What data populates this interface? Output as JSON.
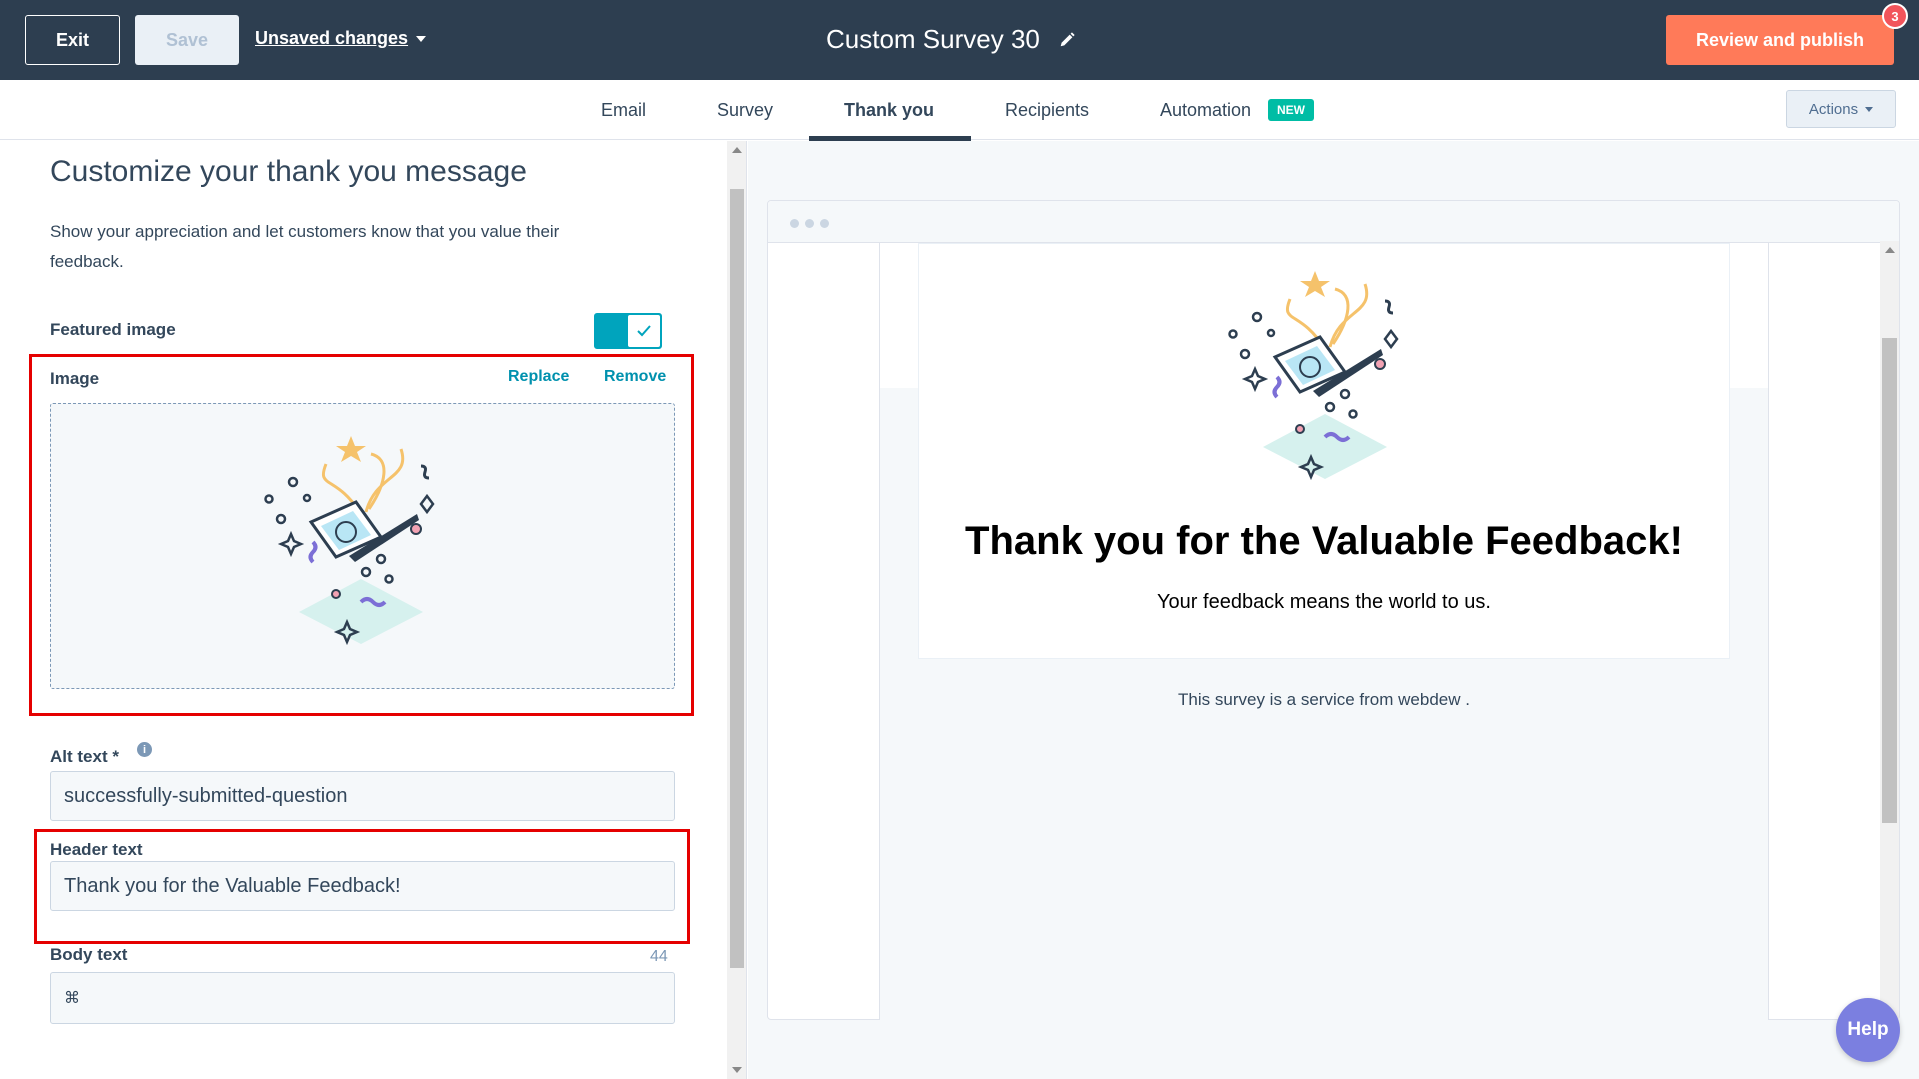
{
  "topbar": {
    "exit_label": "Exit",
    "save_label": "Save",
    "unsaved_label": "Unsaved changes",
    "survey_title": "Custom Survey 30",
    "review_label": "Review and publish",
    "notification_count": "3"
  },
  "tabs": {
    "items": [
      {
        "label": "Email"
      },
      {
        "label": "Survey"
      },
      {
        "label": "Thank you"
      },
      {
        "label": "Recipients"
      },
      {
        "label": "Automation"
      }
    ],
    "active": "Thank you",
    "new_badge": "NEW",
    "actions_label": "Actions"
  },
  "editor": {
    "title": "Customize your thank you message",
    "description": "Show your appreciation and let customers know that you value their feedback.",
    "featured_image_label": "Featured image",
    "featured_image_enabled": true,
    "image_label": "Image",
    "replace_label": "Replace",
    "remove_label": "Remove",
    "alt_text_label": "Alt text *",
    "alt_text_value": "successfully-submitted-question",
    "header_text_label": "Header text",
    "header_text_value": "Thank you for the Valuable Feedback!",
    "header_char_count": "44",
    "body_text_label": "Body text"
  },
  "preview": {
    "header": "Thank you for the Valuable Feedback!",
    "body": "Your feedback means the world to us.",
    "footer": "This survey is a service from webdew ."
  },
  "help_label": "Help",
  "colors": {
    "topbar": "#2d3e50",
    "accent_orange": "#ff7a59",
    "teal": "#00a4bd",
    "highlight_red": "#e50000",
    "new_badge": "#00bda5",
    "help_button": "#7b7fe0"
  }
}
